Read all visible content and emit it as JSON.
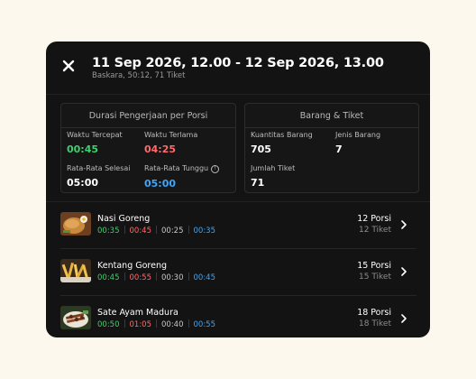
{
  "header": {
    "title": "11 Sep 2026, 12.00 - 12 Sep 2026, 13.00",
    "subtitle": "Baskara, 50:12, 71 Tiket",
    "close_icon": "close-icon"
  },
  "cards": {
    "duration": {
      "title": "Durasi Pengerjaan per Porsi",
      "fastest_label": "Waktu Tercepat",
      "fastest_value": "00:45",
      "longest_label": "Waktu Terlama",
      "longest_value": "04:25",
      "avg_done_label": "Rata-Rata Selesai",
      "avg_done_value": "05:00",
      "avg_wait_label": "Rata-Rata Tunggu",
      "avg_wait_value": "05:00",
      "info_icon": "info-icon"
    },
    "goods": {
      "title": "Barang & Tiket",
      "qty_label": "Kuantitas Barang",
      "qty_value": "705",
      "types_label": "Jenis Barang",
      "types_value": "7",
      "tickets_label": "Jumlah Tiket",
      "tickets_value": "71"
    }
  },
  "items": [
    {
      "name": "Nasi Goreng",
      "times": [
        "00:35",
        "00:45",
        "00:25",
        "00:35"
      ],
      "porsi": "12 Porsi",
      "tiket": "12 Tiket"
    },
    {
      "name": "Kentang Goreng",
      "times": [
        "00:45",
        "00:55",
        "00:30",
        "00:45"
      ],
      "porsi": "15 Porsi",
      "tiket": "15 Tiket"
    },
    {
      "name": "Sate Ayam Madura",
      "times": [
        "00:50",
        "01:05",
        "00:40",
        "00:55"
      ],
      "porsi": "18 Porsi",
      "tiket": "18 Tiket"
    }
  ],
  "colors": {
    "fastest": "#3ecf6e",
    "longest": "#ff6b6b",
    "neutral": "#c8c8c8",
    "wait": "#3aa8ff"
  }
}
